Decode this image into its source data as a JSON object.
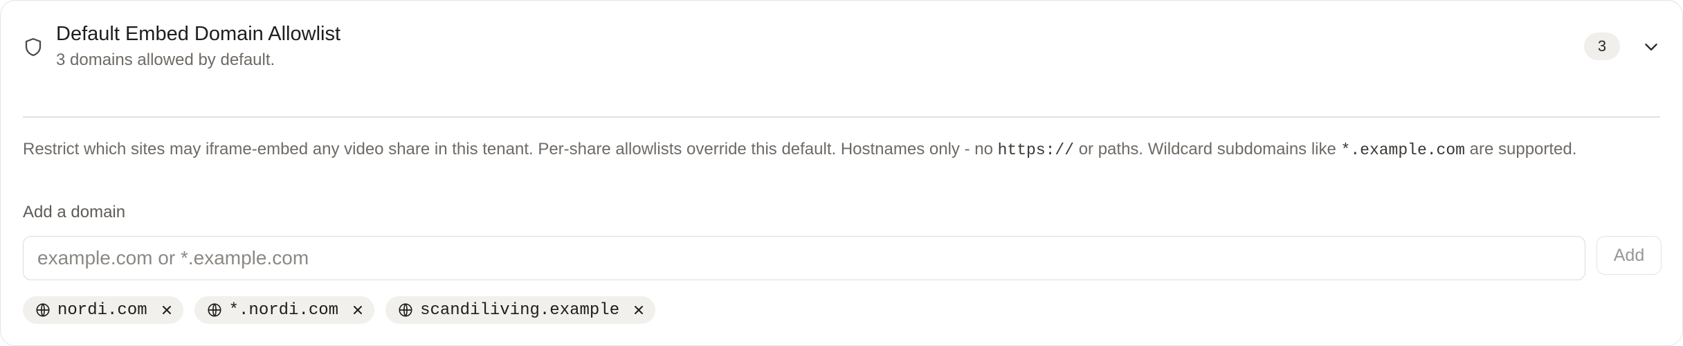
{
  "header": {
    "title": "Default Embed Domain Allowlist",
    "subtitle": "3 domains allowed by default.",
    "count": "3"
  },
  "description": {
    "part1": "Restrict which sites may iframe-embed any video share in this tenant. Per-share allowlists override this default. Hostnames only - no ",
    "code1": "https://",
    "part2": " or paths. Wildcard subdomains like ",
    "code2": "*.example.com",
    "part3": " are supported."
  },
  "form": {
    "label": "Add a domain",
    "placeholder": "example.com or *.example.com",
    "value": "",
    "add_label": "Add"
  },
  "domains": [
    {
      "label": "nordi.com"
    },
    {
      "label": "*.nordi.com"
    },
    {
      "label": "scandiliving.example"
    }
  ],
  "icons": {
    "header": "shield-icon",
    "toggle": "chevron-down-icon",
    "chip": "globe-icon",
    "remove": "close-icon"
  }
}
